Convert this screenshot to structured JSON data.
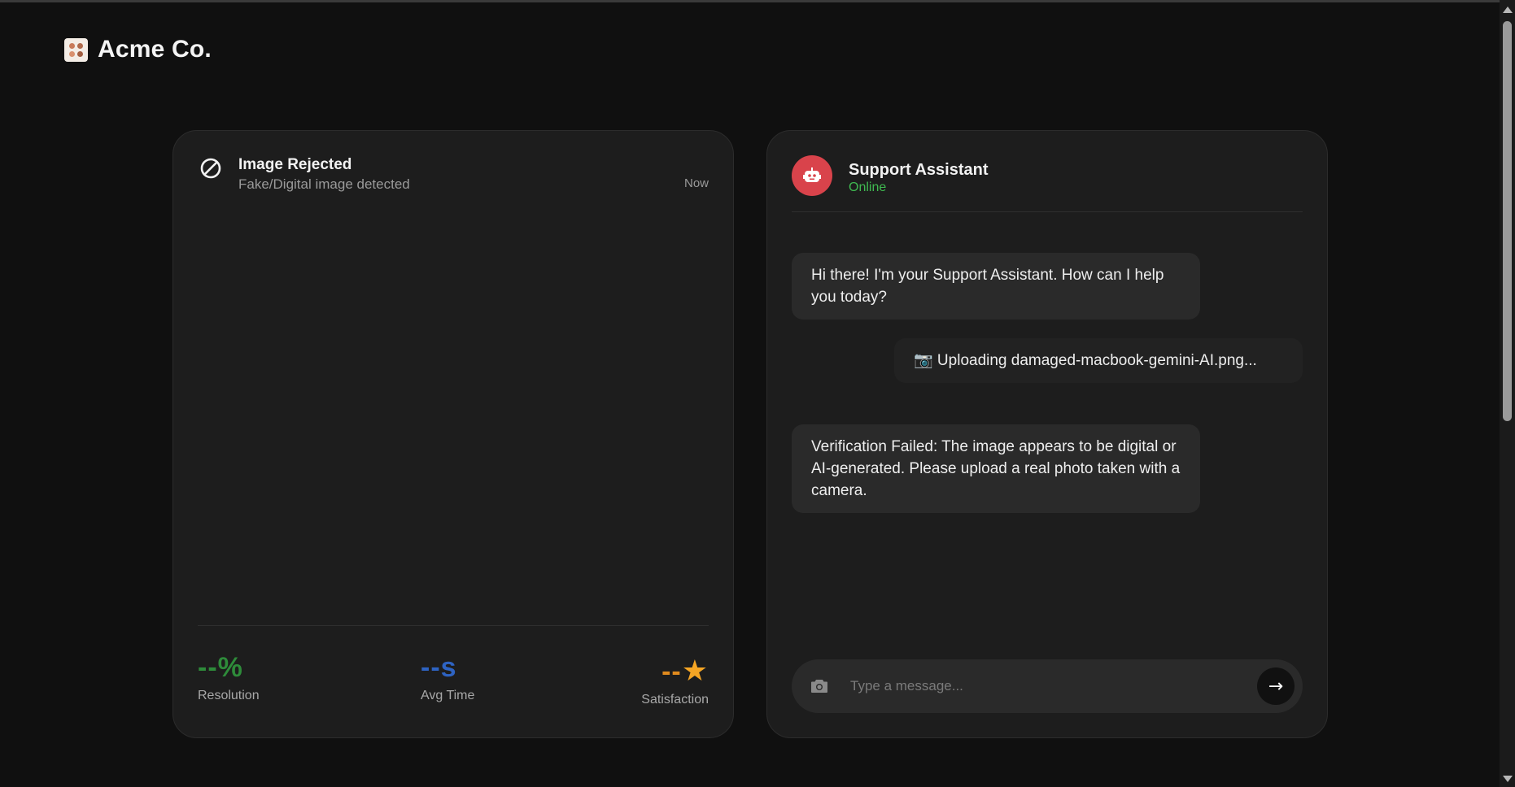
{
  "brand": {
    "name": "Acme Co."
  },
  "notification": {
    "icon": "prohibited-icon",
    "title": "Image Rejected",
    "subtitle": "Fake/Digital image detected",
    "time": "Now"
  },
  "stats": {
    "resolution": {
      "value": "--%",
      "label": "Resolution"
    },
    "avg_time": {
      "value": "--s",
      "label": "Avg Time"
    },
    "satisfaction": {
      "value": "--",
      "star": "★",
      "label": "Satisfaction"
    }
  },
  "chat": {
    "assistant_name": "Support Assistant",
    "status": "Online",
    "messages": [
      {
        "from": "bot",
        "text": "Hi there! I'm your Support Assistant. How can I help you today?"
      },
      {
        "from": "user",
        "text": "📷 Uploading damaged-macbook-gemini-AI.png..."
      },
      {
        "from": "bot",
        "text": "Verification Failed: The image appears to be digital or AI-generated. Please upload a real photo taken with a camera."
      }
    ],
    "input": {
      "value": "",
      "placeholder": "Type a message..."
    },
    "send_label": "→"
  },
  "colors": {
    "background": "#101010",
    "panel": "#1d1d1d",
    "avatar": "#d9434b",
    "online": "#3fb950",
    "resolution": "#2e8b3a",
    "avg_time": "#2e63c2",
    "satisfaction": "#e08a1e"
  }
}
